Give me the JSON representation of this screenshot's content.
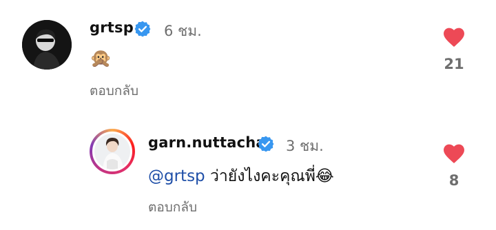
{
  "comments": [
    {
      "username": "grtsp",
      "time": "6 ชม.",
      "text": "🙊",
      "reply_label": "ตอบกลับ",
      "likes": "21",
      "verified": true
    },
    {
      "username": "garn.nuttacha",
      "time": "3 ชม.",
      "mention": "@grtsp",
      "text": "ว่ายังไงคะคุณพี่😂",
      "reply_label": "ตอบกลับ",
      "likes": "8",
      "verified": true
    }
  ],
  "colors": {
    "heart": "#ed4956",
    "verified": "#3897f0",
    "mention": "#1f4fa8",
    "muted": "#6e6e6e"
  },
  "icons": {
    "like": "heart-icon",
    "verified": "verified-badge-icon"
  }
}
